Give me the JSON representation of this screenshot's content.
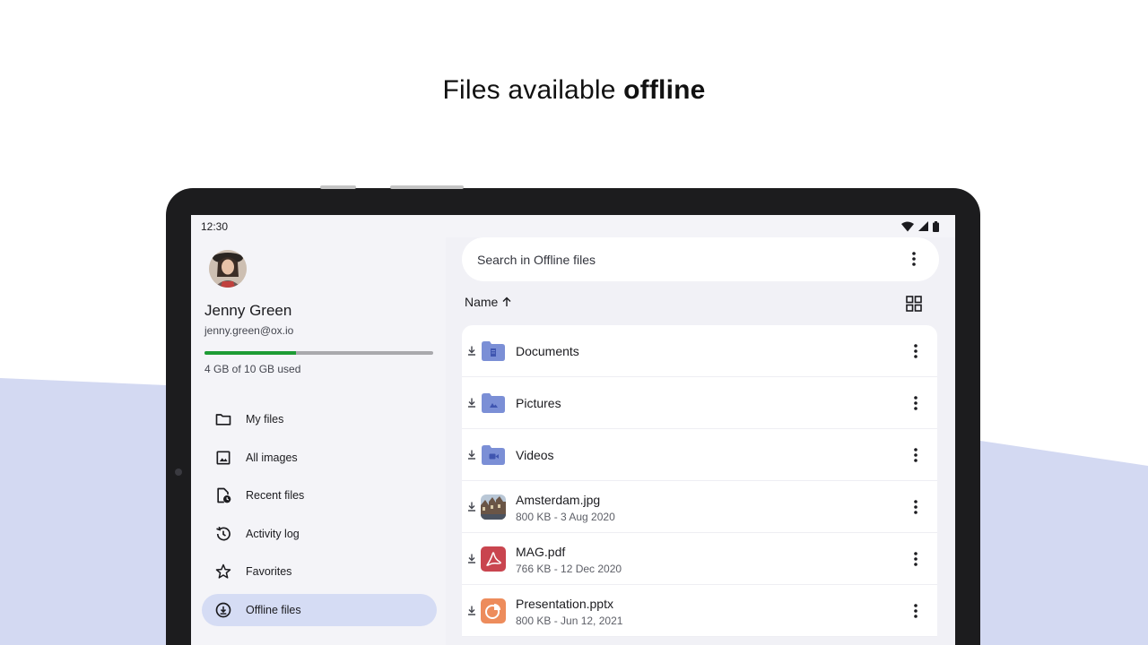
{
  "headline": {
    "prefix": "Files available ",
    "emphasis": "offline"
  },
  "status_bar": {
    "time": "12:30"
  },
  "profile": {
    "name": "Jenny Green",
    "email": "jenny.green@ox.io",
    "quota_text": "4 GB of 10 GB used",
    "quota_fraction": 0.4
  },
  "nav": [
    {
      "label": "My files",
      "icon": "folder-icon"
    },
    {
      "label": "All images",
      "icon": "image-icon"
    },
    {
      "label": "Recent files",
      "icon": "recent-file-icon"
    },
    {
      "label": "Activity log",
      "icon": "history-icon"
    },
    {
      "label": "Favorites",
      "icon": "star-icon"
    },
    {
      "label": "Offline files",
      "icon": "offline-download-icon",
      "active": true
    }
  ],
  "search": {
    "placeholder": "Search in Offline files"
  },
  "sort": {
    "label": "Name",
    "direction": "ascending"
  },
  "files": [
    {
      "name": "Documents",
      "meta": "",
      "type": "folder-documents"
    },
    {
      "name": "Pictures",
      "meta": "",
      "type": "folder-pictures"
    },
    {
      "name": "Videos",
      "meta": "",
      "type": "folder-videos"
    },
    {
      "name": "Amsterdam.jpg",
      "meta": "800 KB - 3 Aug 2020",
      "type": "image"
    },
    {
      "name": "MAG.pdf",
      "meta": "766 KB - 12 Dec 2020",
      "type": "pdf"
    },
    {
      "name": "Presentation.pptx",
      "meta": "800 KB - Jun 12, 2021",
      "type": "pptx"
    }
  ],
  "colors": {
    "accent_nav": "#d5dcf4",
    "quota_fill": "#1e9c35",
    "folder": "#7b8fd6",
    "pdf": "#c9454f",
    "pptx": "#ed8c5c",
    "background_wave": "#d3d9f2"
  }
}
